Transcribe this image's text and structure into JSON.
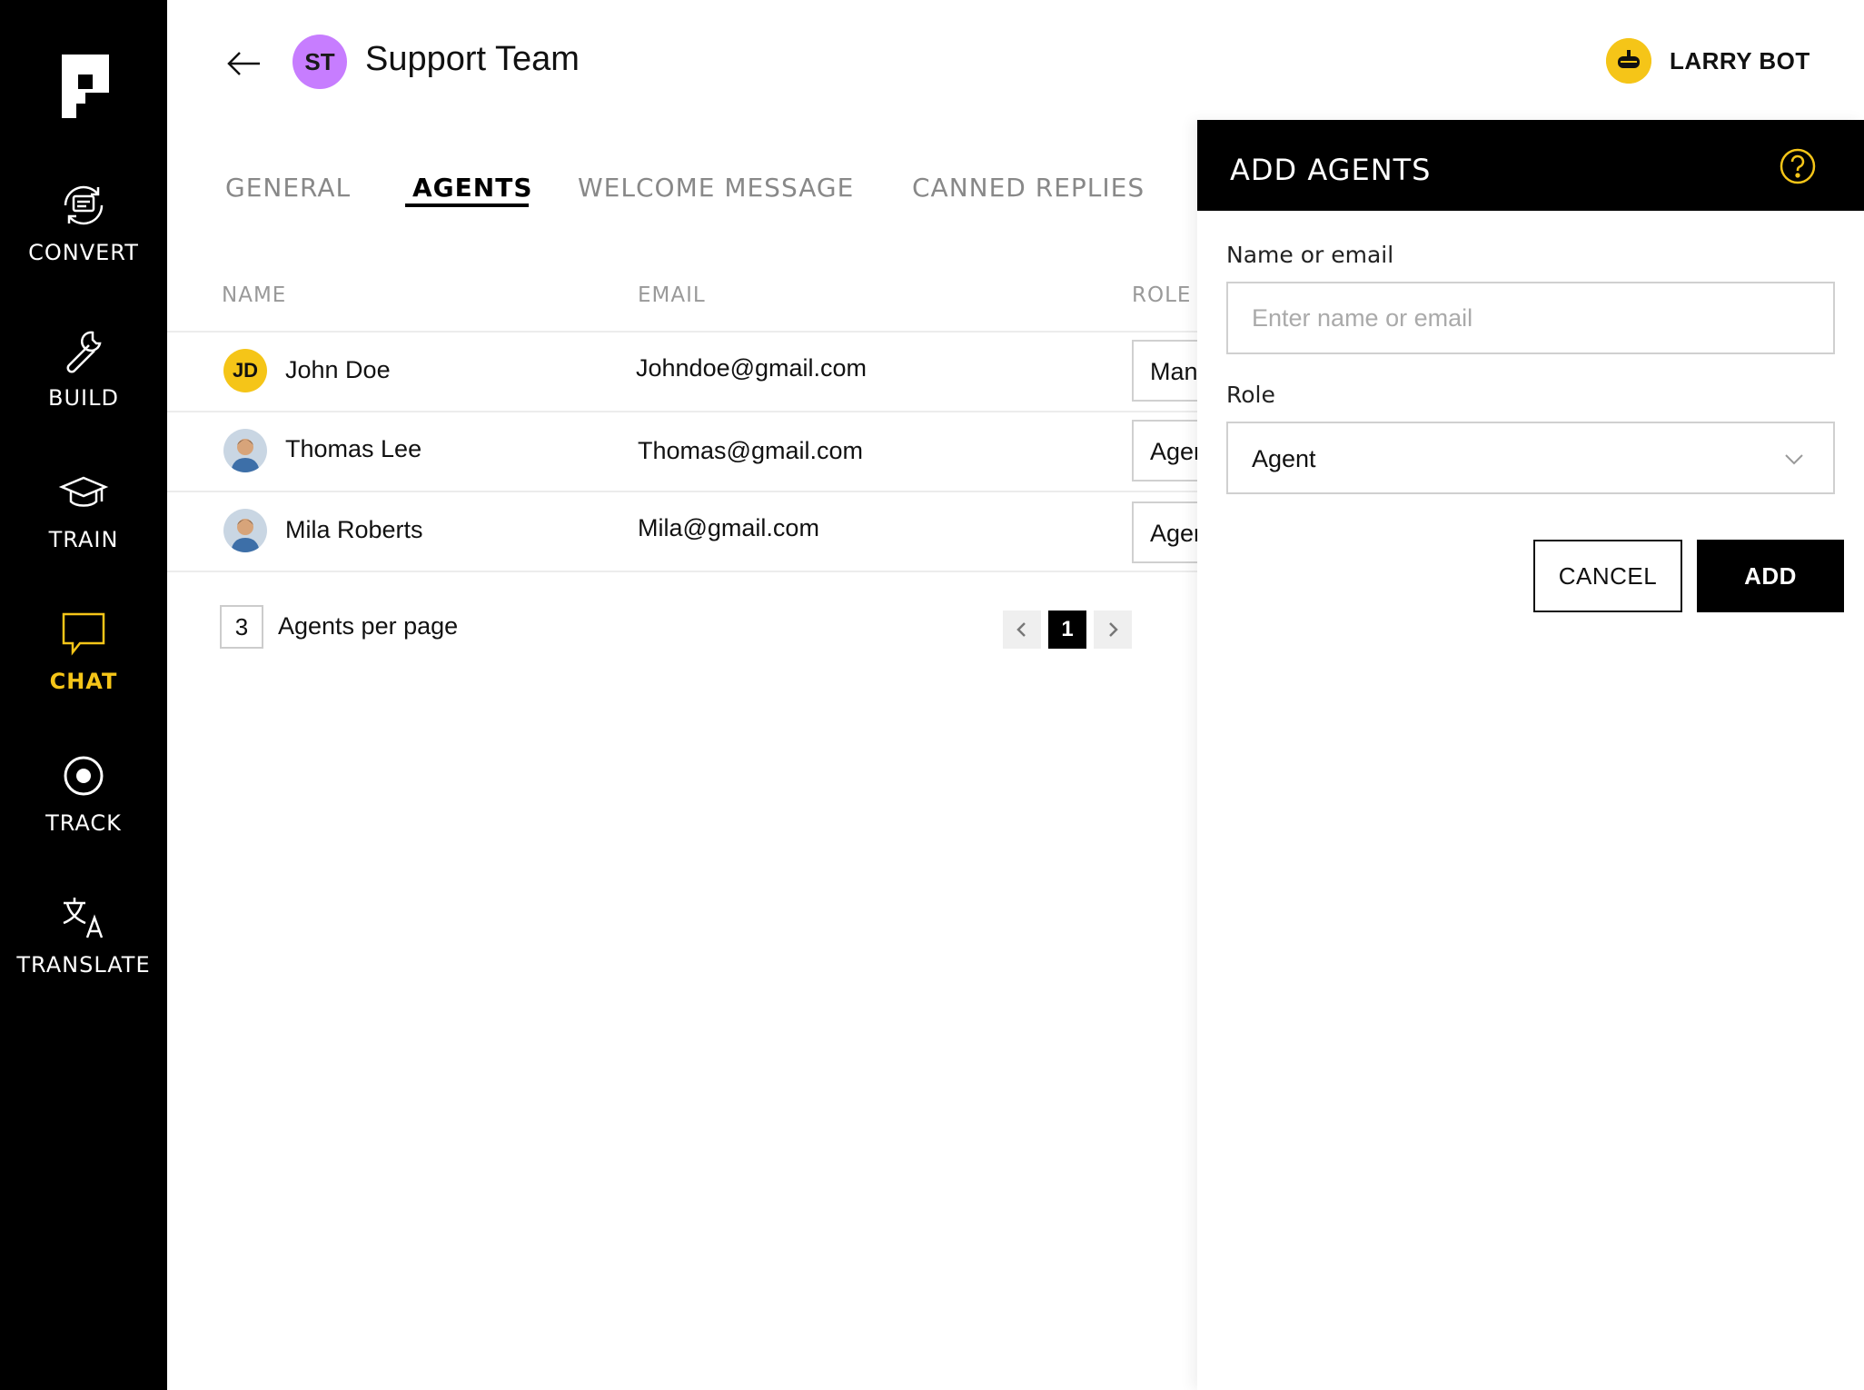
{
  "sidebar": {
    "items": [
      {
        "label": "CONVERT",
        "icon": "convert-icon"
      },
      {
        "label": "BUILD",
        "icon": "wrench-icon"
      },
      {
        "label": "TRAIN",
        "icon": "graduation-cap-icon"
      },
      {
        "label": "CHAT",
        "icon": "chat-bubble-icon",
        "active": true
      },
      {
        "label": "TRACK",
        "icon": "target-icon"
      },
      {
        "label": "TRANSLATE",
        "icon": "translate-icon"
      }
    ]
  },
  "header": {
    "team_initials": "ST",
    "team_name": "Support Team",
    "bot_name": "LARRY BOT"
  },
  "tabs": [
    {
      "label": "GENERAL",
      "active": false
    },
    {
      "label": "AGENTS",
      "active": true
    },
    {
      "label": "WELCOME MESSAGE",
      "active": false
    },
    {
      "label": "CANNED REPLIES",
      "active": false
    }
  ],
  "table": {
    "headers": {
      "name": "NAME",
      "email": "EMAIL",
      "role": "ROLE"
    },
    "rows": [
      {
        "avatar": "JD",
        "name": "John Doe",
        "email": "Johndoe@gmail.com",
        "role": "Manager"
      },
      {
        "avatar": "photo",
        "name": "Thomas Lee",
        "email": "Thomas@gmail.com",
        "role": "Agent"
      },
      {
        "avatar": "photo",
        "name": "Mila Roberts",
        "email": "Mila@gmail.com",
        "role": "Agent"
      }
    ]
  },
  "pagination": {
    "per_page": "3",
    "per_page_label": "Agents per page",
    "current_page": "1",
    "prev": "‹",
    "next": "›"
  },
  "drawer": {
    "title": "ADD AGENTS",
    "name_label": "Name or email",
    "name_placeholder": "Enter name or email",
    "name_value": "",
    "role_label": "Role",
    "role_value": "Agent",
    "cancel_label": "CANCEL",
    "add_label": "ADD"
  },
  "colors": {
    "accent": "#f5c518",
    "team_avatar": "#c77dff",
    "sidebar_bg": "#000000"
  }
}
